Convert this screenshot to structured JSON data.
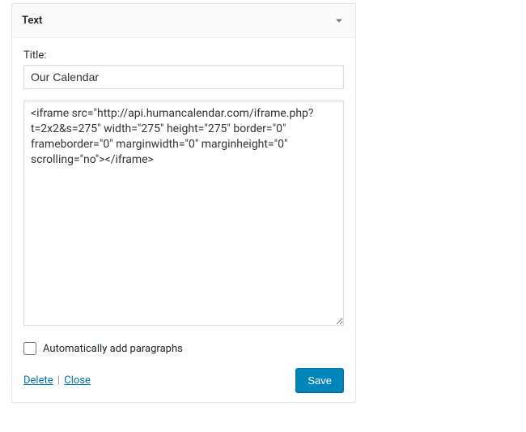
{
  "widget": {
    "header_title": "Text",
    "title_label": "Title:",
    "title_value": "Our Calendar",
    "content_value": "<iframe src=\"http://api.humancalendar.com/iframe.php?t=2x2&s=275\" width=\"275\" height=\"275\" border=\"0\" frameborder=\"0\" marginwidth=\"0\" marginheight=\"0\" scrolling=\"no\"></iframe>",
    "autop_label": "Automatically add paragraphs",
    "delete_label": "Delete",
    "close_label": "Close",
    "save_label": "Save"
  }
}
